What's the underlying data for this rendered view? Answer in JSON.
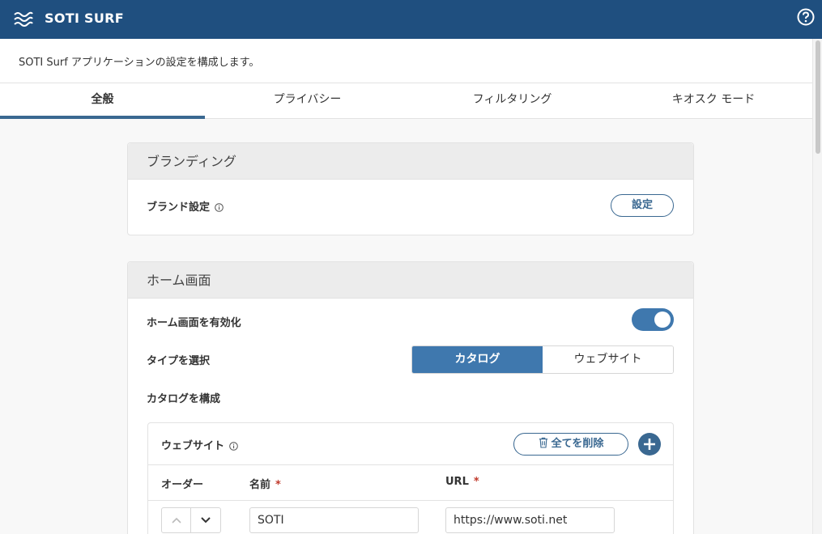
{
  "header": {
    "app_title": "SOTI SURF",
    "logo_icon": "waves-icon",
    "help_icon": "help-circle-icon"
  },
  "description": "SOTI Surf アプリケーションの設定を構成します。",
  "tabs": [
    {
      "label": "全般",
      "active": true
    },
    {
      "label": "プライバシー",
      "active": false
    },
    {
      "label": "フィルタリング",
      "active": false
    },
    {
      "label": "キオスク モード",
      "active": false
    }
  ],
  "branding": {
    "title": "ブランディング",
    "brand_setting_label": "ブランド設定",
    "configure_button": "設定"
  },
  "home_screen": {
    "title": "ホーム画面",
    "enable_label": "ホーム画面を有効化",
    "enabled": true,
    "type_label": "タイプを選択",
    "type_options": [
      "カタログ",
      "ウェブサイト"
    ],
    "type_selected": "カタログ",
    "configure_catalog_label": "カタログを構成",
    "websites": {
      "title": "ウェブサイト",
      "delete_all_button": "全てを削除",
      "columns": {
        "order": "オーダー",
        "name": "名前",
        "url": "URL",
        "required_mark": "*"
      },
      "rows": [
        {
          "name": "SOTI",
          "url": "https://www.soti.net"
        }
      ]
    }
  },
  "colors": {
    "header_bg": "#1f4f7f",
    "accent": "#3a6891",
    "toggle_on": "#3f78ae",
    "required": "#c0392b"
  }
}
